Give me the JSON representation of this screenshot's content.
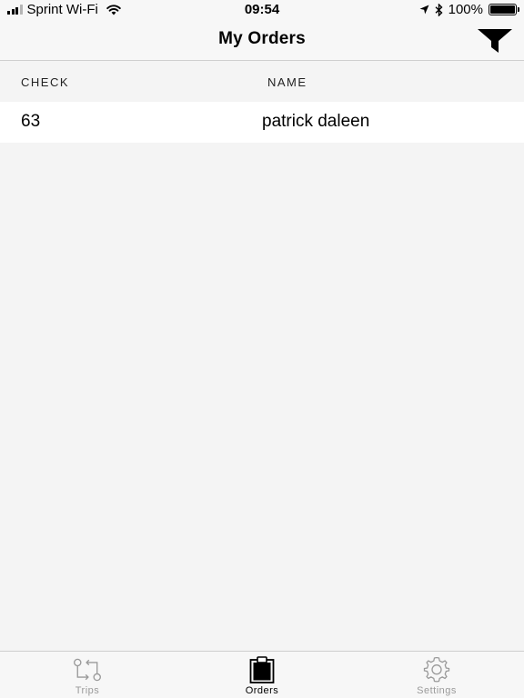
{
  "status_bar": {
    "carrier": "Sprint Wi-Fi",
    "time": "09:54",
    "battery_percent": "100%",
    "battery_level": 1.0,
    "signal_bars": 3,
    "signal_bars_total": 4,
    "icons": [
      "signal-icon",
      "wifi-icon",
      "location-arrow-icon",
      "bluetooth-icon",
      "battery-icon"
    ]
  },
  "nav": {
    "title": "My Orders",
    "right_icon": "filter-icon"
  },
  "table": {
    "columns": [
      "CHECK",
      "NAME"
    ],
    "rows": [
      {
        "check": "63",
        "name": "patrick daleen"
      }
    ]
  },
  "tabs": [
    {
      "label": "Trips",
      "icon": "trips-route-icon",
      "active": false
    },
    {
      "label": "Orders",
      "icon": "clipboard-icon",
      "active": true
    },
    {
      "label": "Settings",
      "icon": "gear-icon",
      "active": false
    }
  ],
  "colors": {
    "bar_background": "#f7f7f7",
    "content_background": "#f4f4f4",
    "row_background": "#ffffff",
    "active_tab": "#000000",
    "inactive_tab": "#9a9a9a"
  }
}
